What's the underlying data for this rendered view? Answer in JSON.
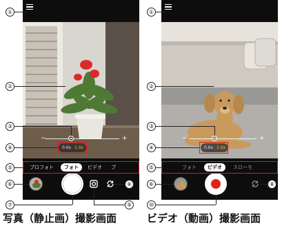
{
  "photo_screen": {
    "caption": "写真（静止画）撮影画面",
    "modes": [
      "プロフォト",
      "フォト",
      "ビデオ",
      "プ"
    ],
    "selected_mode": "フォト",
    "zoom": {
      "left": "0.6x",
      "right": "1.0x"
    },
    "slider": {
      "minus": "−",
      "plus": "+"
    },
    "callouts": [
      "①",
      "②",
      "③",
      "④",
      "⑤",
      "⑥",
      "⑦",
      "⑧",
      "⑨"
    ]
  },
  "video_screen": {
    "caption": "ビデオ（動画）撮影画面",
    "modes": [
      "フォト",
      "ビデオ",
      "スローモ"
    ],
    "selected_mode": "ビデオ",
    "zoom": {
      "left": "0.6x",
      "right": "1.0x"
    },
    "slider": {
      "minus": "−",
      "plus": "+"
    },
    "callouts": [
      "①",
      "②",
      "③",
      "④",
      "⑤",
      "⑥",
      "⑧",
      "⑩"
    ]
  },
  "colors": {
    "record": "#e2231a",
    "highlight": "#e8141c",
    "zoom_active": "#f5c400"
  }
}
